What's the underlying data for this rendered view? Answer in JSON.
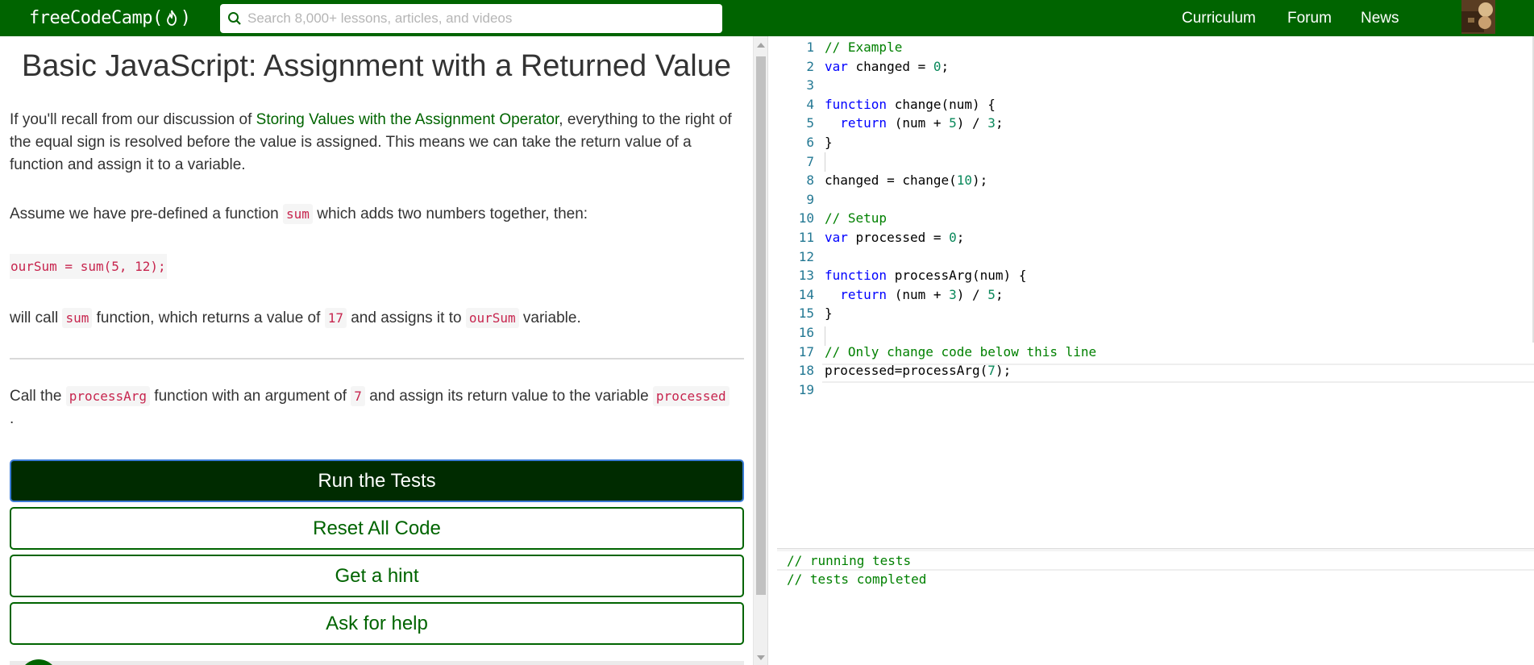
{
  "navbar": {
    "logo_text": "freeCodeCamp(",
    "logo_close": ")",
    "search_placeholder": "Search 8,000+ lessons, articles, and videos",
    "links": [
      "Curriculum",
      "Forum",
      "News"
    ]
  },
  "lesson": {
    "title": "Basic JavaScript: Assignment with a Returned Value",
    "p1_before": "If you'll recall from our discussion of ",
    "p1_link": "Storing Values with the Assignment Operator",
    "p1_after": ", everything to the right of the equal sign is resolved before the value is assigned. This means we can take the return value of a function and assign it to a variable.",
    "p2_before": "Assume we have pre-defined a function ",
    "p2_code": "sum",
    "p2_after": " which adds two numbers together, then:",
    "codeblock": "ourSum = sum(5, 12);",
    "p3_a": "will call ",
    "p3_code1": "sum",
    "p3_b": " function, which returns a value of ",
    "p3_code2": "17",
    "p3_c": " and assigns it to ",
    "p3_code3": "ourSum",
    "p3_d": " variable.",
    "task_a": "Call the ",
    "task_code1": "processArg",
    "task_b": " function with an argument of ",
    "task_code2": "7",
    "task_c": " and assign its return value to the variable ",
    "task_code3": "processed",
    "task_d": "."
  },
  "buttons": {
    "run": "Run the Tests",
    "reset": "Reset All Code",
    "hint": "Get a hint",
    "help": "Ask for help"
  },
  "editor": {
    "lines": [
      {
        "n": "1",
        "t": [
          [
            "c",
            "// Example"
          ]
        ]
      },
      {
        "n": "2",
        "t": [
          [
            "k",
            "var"
          ],
          [
            "p",
            " changed = "
          ],
          [
            "n",
            "0"
          ],
          [
            "p",
            ";"
          ]
        ]
      },
      {
        "n": "3",
        "t": []
      },
      {
        "n": "4",
        "t": [
          [
            "k",
            "function"
          ],
          [
            "p",
            " change(num) {"
          ]
        ]
      },
      {
        "n": "5",
        "t": [
          [
            "p",
            "  "
          ],
          [
            "k",
            "return"
          ],
          [
            "p",
            " (num + "
          ],
          [
            "n",
            "5"
          ],
          [
            "p",
            ") / "
          ],
          [
            "n",
            "3"
          ],
          [
            "p",
            ";"
          ]
        ]
      },
      {
        "n": "6",
        "t": [
          [
            "p",
            "}"
          ]
        ]
      },
      {
        "n": "7",
        "t": []
      },
      {
        "n": "8",
        "t": [
          [
            "p",
            "changed = change("
          ],
          [
            "n",
            "10"
          ],
          [
            "p",
            ");"
          ]
        ]
      },
      {
        "n": "9",
        "t": []
      },
      {
        "n": "10",
        "t": [
          [
            "c",
            "// Setup"
          ]
        ]
      },
      {
        "n": "11",
        "t": [
          [
            "k",
            "var"
          ],
          [
            "p",
            " processed = "
          ],
          [
            "n",
            "0"
          ],
          [
            "p",
            ";"
          ]
        ]
      },
      {
        "n": "12",
        "t": []
      },
      {
        "n": "13",
        "t": [
          [
            "k",
            "function"
          ],
          [
            "p",
            " processArg(num) {"
          ]
        ]
      },
      {
        "n": "14",
        "t": [
          [
            "p",
            "  "
          ],
          [
            "k",
            "return"
          ],
          [
            "p",
            " (num + "
          ],
          [
            "n",
            "3"
          ],
          [
            "p",
            ") / "
          ],
          [
            "n",
            "5"
          ],
          [
            "p",
            ";"
          ]
        ]
      },
      {
        "n": "15",
        "t": [
          [
            "p",
            "}"
          ]
        ]
      },
      {
        "n": "16",
        "t": []
      },
      {
        "n": "17",
        "t": [
          [
            "c",
            "// Only change code below this line"
          ]
        ]
      },
      {
        "n": "18",
        "t": [
          [
            "p",
            "processed=processArg("
          ],
          [
            "n",
            "7"
          ],
          [
            "p",
            ");"
          ]
        ]
      },
      {
        "n": "19",
        "t": []
      }
    ]
  },
  "output": {
    "line1": "// running tests",
    "line2": "// tests completed"
  },
  "colors": {
    "brand": "#006400",
    "run_button": "#002b00",
    "code_inline": "#c7254e",
    "comment": "#008000",
    "keyword": "#0000ff",
    "number": "#09885a",
    "line_number": "#237893"
  }
}
